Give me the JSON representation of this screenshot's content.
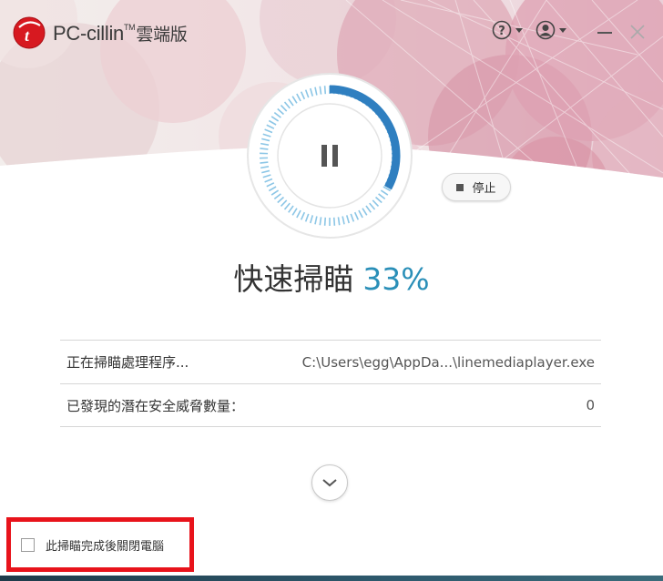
{
  "app": {
    "brand": "PC-cillin",
    "trademark": "TM",
    "brand_suffix": "雲端版"
  },
  "header": {
    "help_icon": "help-icon",
    "account_icon": "account-icon",
    "minimize_icon": "minimize-icon",
    "close_icon": "close-icon"
  },
  "scan": {
    "state_icon": "pause-icon",
    "progress": 33,
    "stop_label": "停止",
    "title": "快速掃瞄",
    "percent_text": "33%"
  },
  "details": {
    "rows": [
      {
        "label": "正在掃瞄處理程序...",
        "value": "C:\\Users\\egg\\AppDa...\\linemediaplayer.exe"
      },
      {
        "label": "已發現的潛在安全威脅數量：",
        "value": "0"
      }
    ]
  },
  "footer": {
    "shutdown_label": "此掃瞄完成後關閉電腦",
    "shutdown_checked": false
  },
  "colors": {
    "accent": "#2a8fb8",
    "progress_arc": "#2f7fc0",
    "highlight_border": "#e8131b",
    "brand_red": "#d71920"
  }
}
